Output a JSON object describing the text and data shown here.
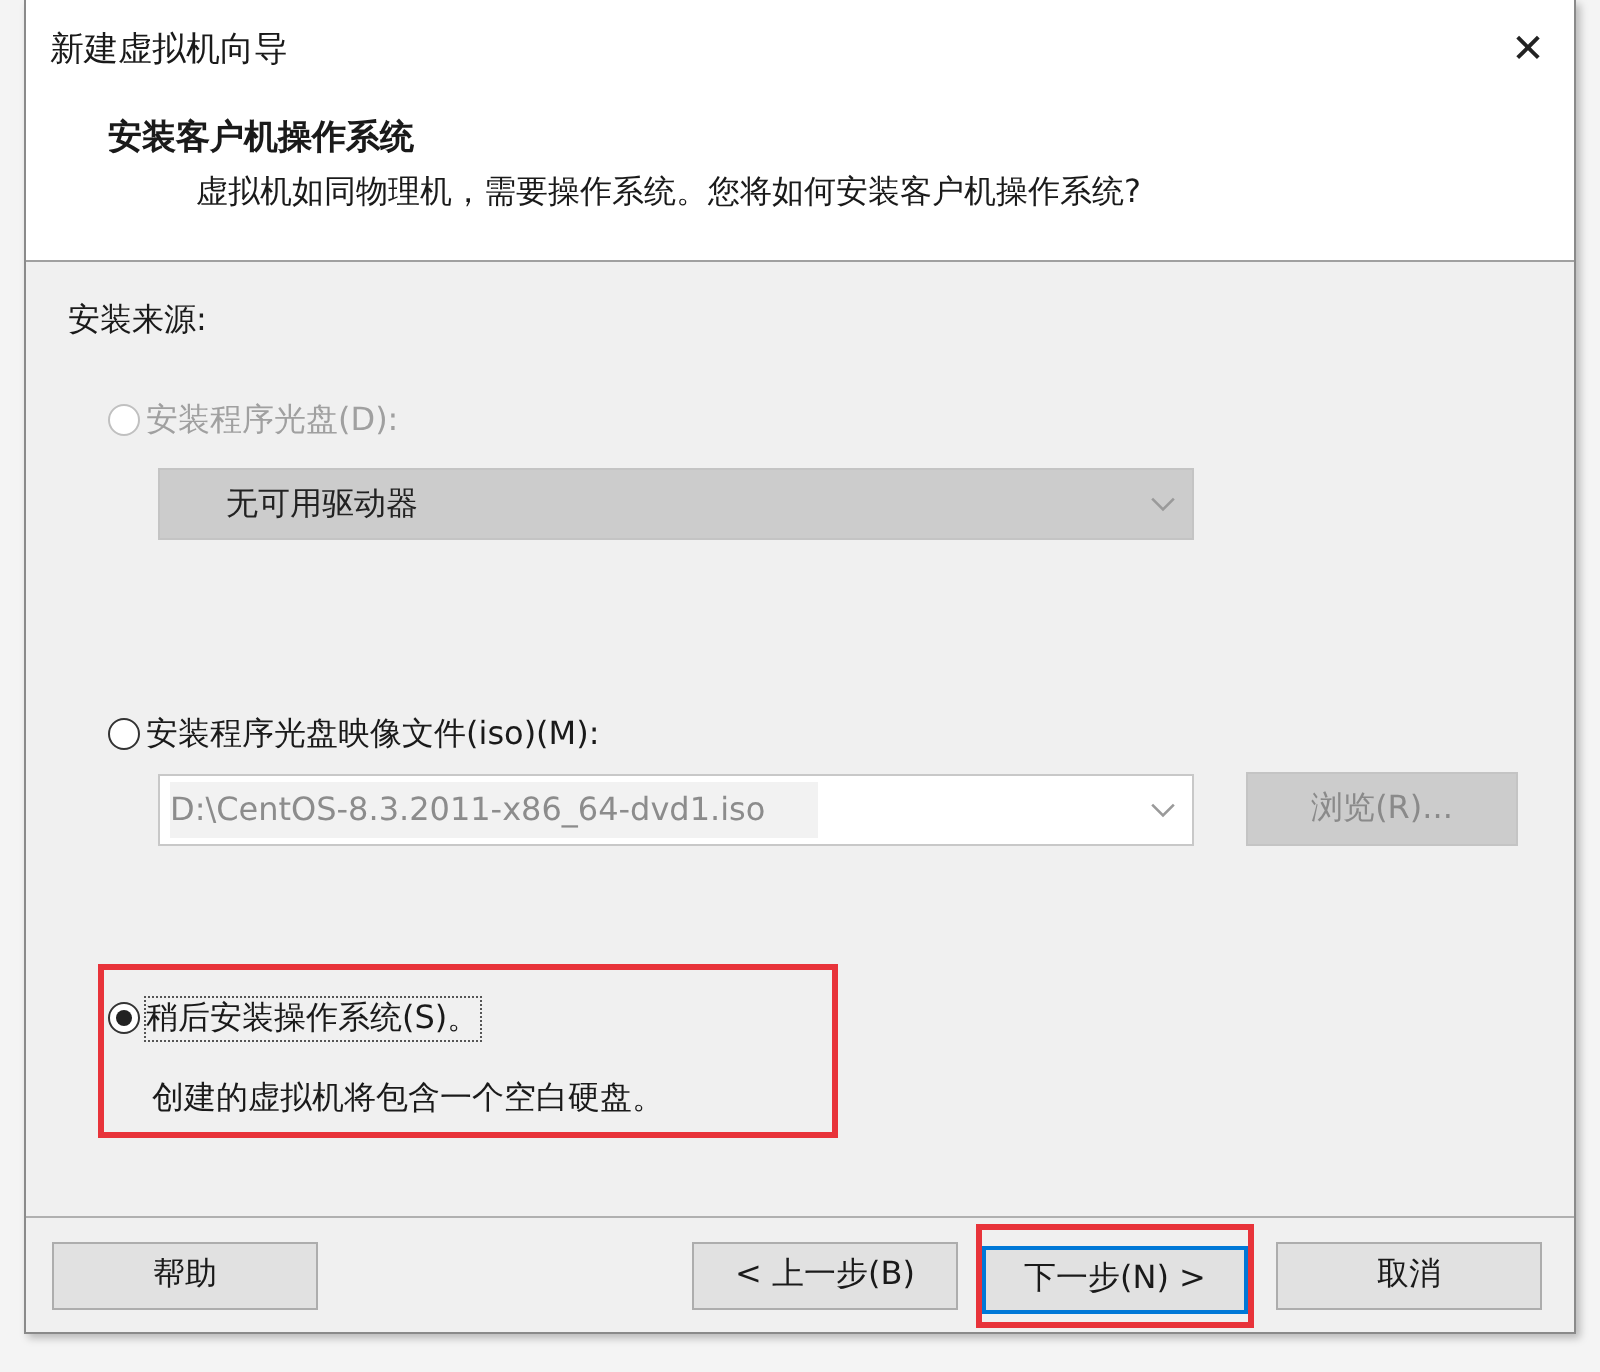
{
  "window": {
    "title": "新建虚拟机向导",
    "close": "✕"
  },
  "header": {
    "title": "安装客户机操作系统",
    "subtitle": "虚拟机如同物理机，需要操作系统。您将如何安装客户机操作系统?"
  },
  "source_label": "安装来源:",
  "options": [
    {
      "label": "安装程序光盘(D):",
      "selected": false,
      "disabled": true,
      "control": {
        "kind": "dropdown",
        "value": "无可用驱动器",
        "disabled": true
      }
    },
    {
      "label": "安装程序光盘映像文件(iso)(M):",
      "selected": false,
      "disabled": false,
      "control": {
        "kind": "combo",
        "value": "D:\\CentOS-8.3.2011-x86_64-dvd1.iso",
        "disabled": true,
        "button": "浏览(R)..."
      }
    },
    {
      "label": "稍后安装操作系统(S)。",
      "selected": true,
      "disabled": false,
      "highlighted": true,
      "description": "创建的虚拟机将包含一个空白硬盘。"
    }
  ],
  "buttons": [
    {
      "kind": "help",
      "label": "帮助",
      "default": false
    },
    {
      "kind": "back",
      "label": "< 上一步(B)",
      "default": false
    },
    {
      "kind": "next",
      "label": "下一步(N) >",
      "default": true,
      "highlighted": true
    },
    {
      "kind": "cancel",
      "label": "取消",
      "default": false
    }
  ]
}
